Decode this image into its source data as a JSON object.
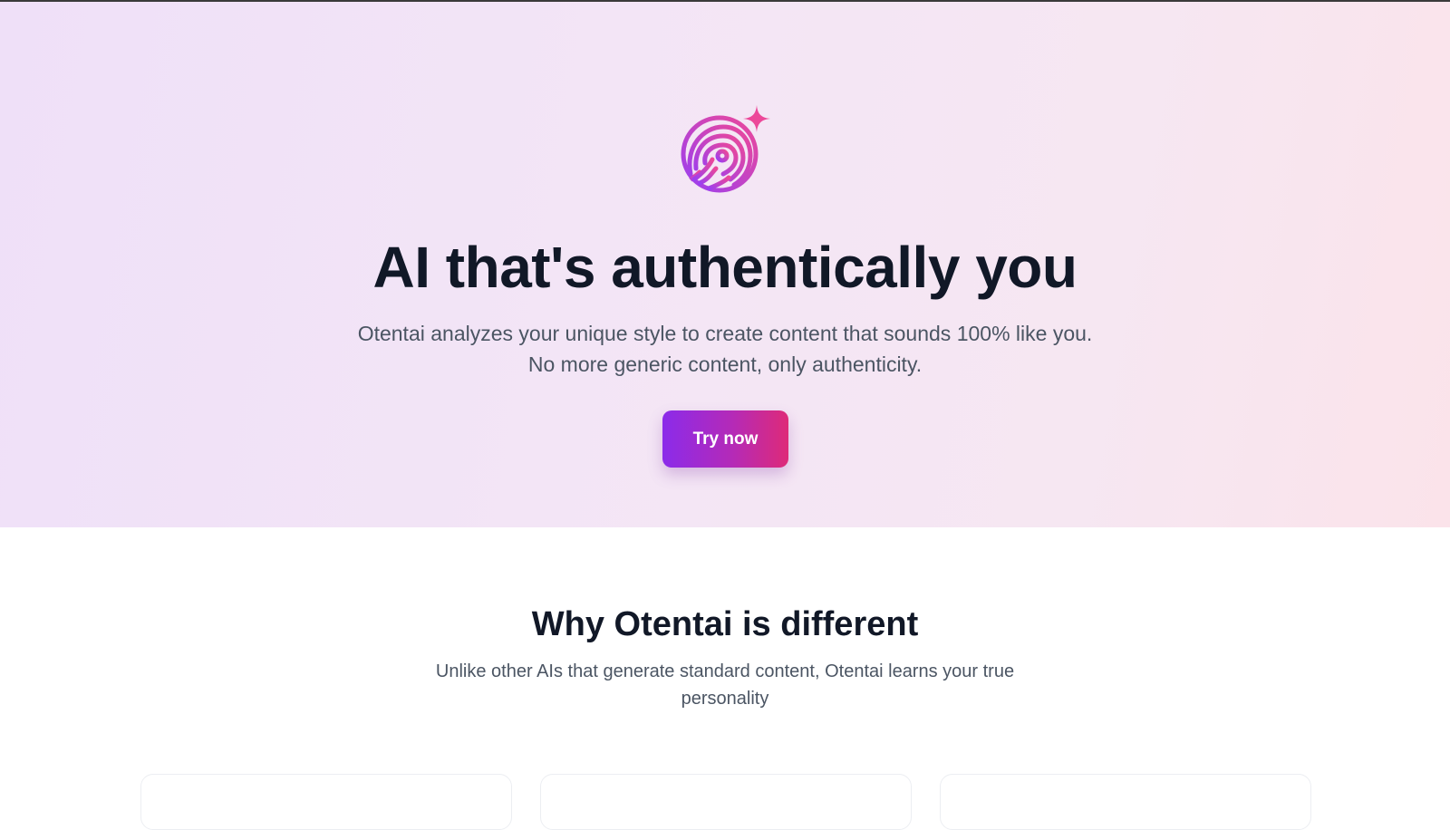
{
  "hero": {
    "logo_icon": "fingerprint-sparkle-icon",
    "title": "AI that's authentically you",
    "subtitle": "Otentai analyzes your unique style to create content that sounds 100% like you. No more generic content, only authenticity.",
    "cta_label": "Try now"
  },
  "features": {
    "title": "Why Otentai is different",
    "subtitle": "Unlike other AIs that generate standard content, Otentai learns your true personality"
  },
  "colors": {
    "accent_start": "#8b2bea",
    "accent_end": "#de2a78",
    "heading": "#111827",
    "body_text": "#4b5563"
  }
}
